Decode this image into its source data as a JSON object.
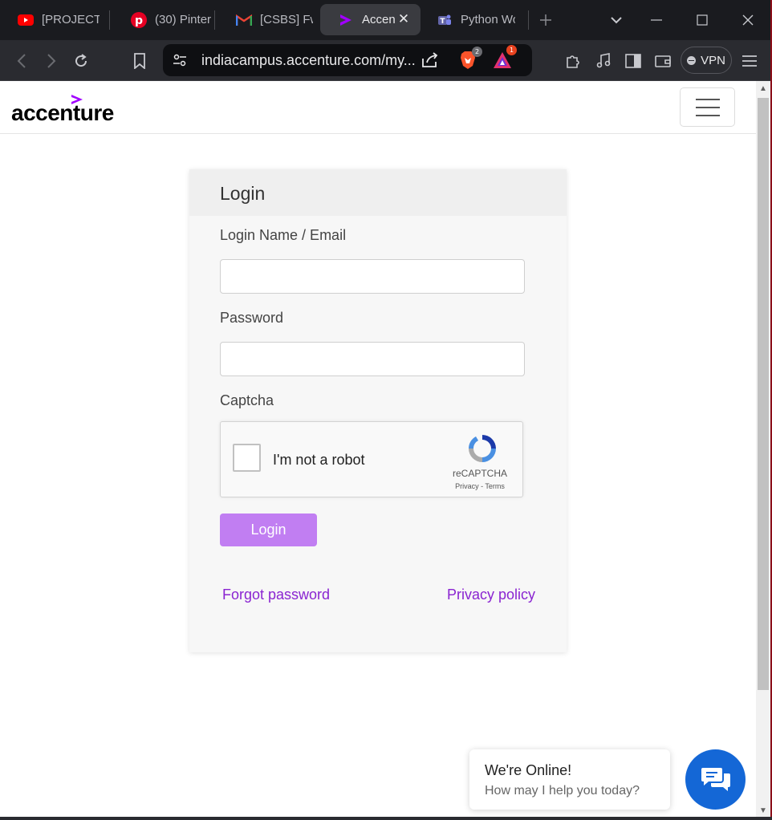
{
  "browser": {
    "tabs": [
      {
        "title": "[PROJECT",
        "icon": "youtube-icon",
        "color": "#ff0000"
      },
      {
        "title": "(30) Pinter",
        "icon": "pinterest-icon",
        "color": "#e60023"
      },
      {
        "title": "[CSBS] Fwd",
        "icon": "gmail-icon",
        "color": "#ea4335"
      },
      {
        "title": "Accen",
        "icon": "accenture-icon",
        "color": "#a100ff"
      },
      {
        "title": "Python Wo",
        "icon": "teams-icon",
        "color": "#6264a7"
      }
    ],
    "url": "indiacampus.accenture.com/my...",
    "brave_badge": "2",
    "rewards_badge": "1",
    "vpn_label": "VPN"
  },
  "site": {
    "logo": "accenture",
    "accent_color": "#a100ff"
  },
  "login": {
    "title": "Login",
    "email_label": "Login Name / Email",
    "email_value": "",
    "password_label": "Password",
    "password_value": "",
    "captcha_label": "Captcha",
    "captcha_text": "I'm not a robot",
    "captcha_brand": "reCAPTCHA",
    "captcha_links": "Privacy - Terms",
    "button_label": "Login",
    "button_color": "#c17ef2",
    "forgot_link": "Forgot password",
    "privacy_link": "Privacy policy"
  },
  "chat": {
    "title": "We're Online!",
    "subtitle": "How may I help you today?"
  }
}
